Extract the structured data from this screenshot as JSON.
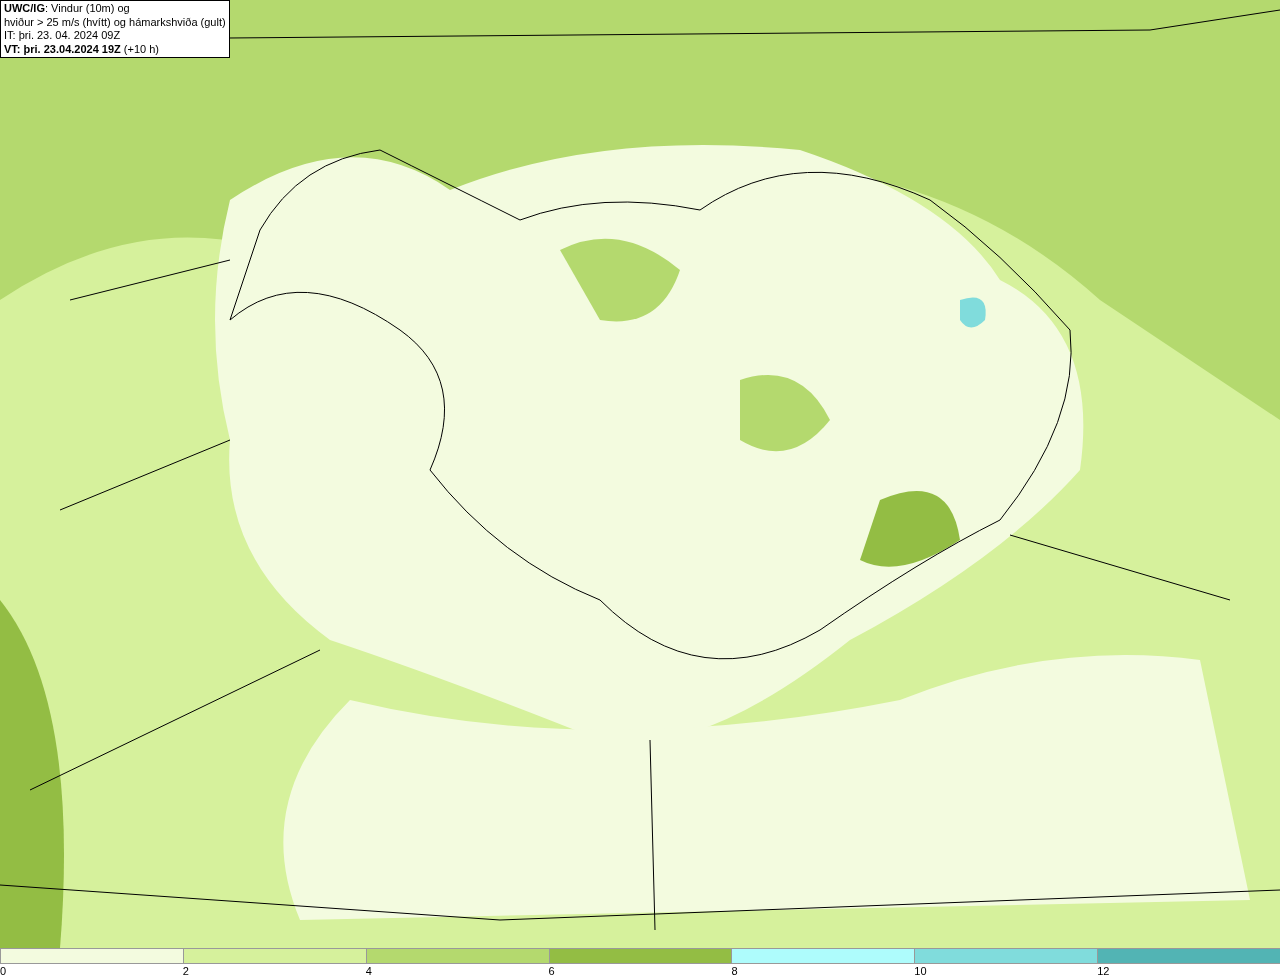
{
  "title_box": {
    "lines": [
      "**UWC/IG**: Vindur (10m) og",
      "hviður > 25 m/s (hvítt) og hámarkshviða (gult)",
      "IT: þri. 23. 04. 2024 09Z",
      "**VT: þri. 23.04.2024 19Z** (+10 h)"
    ]
  },
  "legend": {
    "bins": [
      {
        "label": "0",
        "color": "#f3fbdf"
      },
      {
        "label": "2",
        "color": "#d6f19c"
      },
      {
        "label": "4",
        "color": "#b4d96e"
      },
      {
        "label": "6",
        "color": "#93bd44"
      },
      {
        "label": "8",
        "color": "#aefcfc"
      },
      {
        "label": "10",
        "color": "#80dcdc"
      },
      {
        "label": "12",
        "color": "#52b4b4"
      }
    ]
  }
}
